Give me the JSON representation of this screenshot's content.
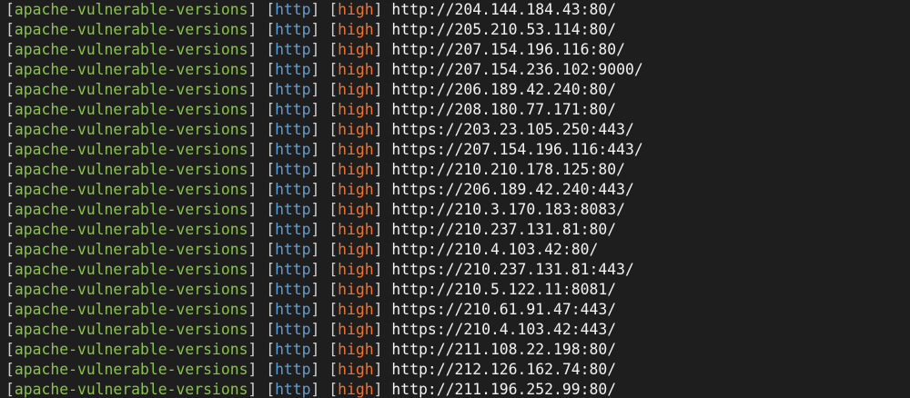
{
  "terminal": {
    "rows": [
      {
        "template": "apache-vulnerable-versions",
        "protocol": "http",
        "severity": "high",
        "url": "http://204.144.184.43:80/"
      },
      {
        "template": "apache-vulnerable-versions",
        "protocol": "http",
        "severity": "high",
        "url": "http://205.210.53.114:80/"
      },
      {
        "template": "apache-vulnerable-versions",
        "protocol": "http",
        "severity": "high",
        "url": "http://207.154.196.116:80/"
      },
      {
        "template": "apache-vulnerable-versions",
        "protocol": "http",
        "severity": "high",
        "url": "http://207.154.236.102:9000/"
      },
      {
        "template": "apache-vulnerable-versions",
        "protocol": "http",
        "severity": "high",
        "url": "http://206.189.42.240:80/"
      },
      {
        "template": "apache-vulnerable-versions",
        "protocol": "http",
        "severity": "high",
        "url": "http://208.180.77.171:80/"
      },
      {
        "template": "apache-vulnerable-versions",
        "protocol": "http",
        "severity": "high",
        "url": "https://203.23.105.250:443/"
      },
      {
        "template": "apache-vulnerable-versions",
        "protocol": "http",
        "severity": "high",
        "url": "https://207.154.196.116:443/"
      },
      {
        "template": "apache-vulnerable-versions",
        "protocol": "http",
        "severity": "high",
        "url": "http://210.210.178.125:80/"
      },
      {
        "template": "apache-vulnerable-versions",
        "protocol": "http",
        "severity": "high",
        "url": "https://206.189.42.240:443/"
      },
      {
        "template": "apache-vulnerable-versions",
        "protocol": "http",
        "severity": "high",
        "url": "http://210.3.170.183:8083/"
      },
      {
        "template": "apache-vulnerable-versions",
        "protocol": "http",
        "severity": "high",
        "url": "http://210.237.131.81:80/"
      },
      {
        "template": "apache-vulnerable-versions",
        "protocol": "http",
        "severity": "high",
        "url": "http://210.4.103.42:80/"
      },
      {
        "template": "apache-vulnerable-versions",
        "protocol": "http",
        "severity": "high",
        "url": "https://210.237.131.81:443/"
      },
      {
        "template": "apache-vulnerable-versions",
        "protocol": "http",
        "severity": "high",
        "url": "http://210.5.122.11:8081/"
      },
      {
        "template": "apache-vulnerable-versions",
        "protocol": "http",
        "severity": "high",
        "url": "https://210.61.91.47:443/"
      },
      {
        "template": "apache-vulnerable-versions",
        "protocol": "http",
        "severity": "high",
        "url": "https://210.4.103.42:443/"
      },
      {
        "template": "apache-vulnerable-versions",
        "protocol": "http",
        "severity": "high",
        "url": "http://211.108.22.198:80/"
      },
      {
        "template": "apache-vulnerable-versions",
        "protocol": "http",
        "severity": "high",
        "url": "http://212.126.162.74:80/"
      },
      {
        "template": "apache-vulnerable-versions",
        "protocol": "http",
        "severity": "high",
        "url": "http://211.196.252.99:80/"
      }
    ]
  },
  "colors": {
    "background": "#1e1e1e",
    "template": "#8ac34a",
    "protocol": "#5e9fd6",
    "severity": "#f0742f",
    "url": "#f2f2f2",
    "brackets": "#d0d0d0"
  }
}
